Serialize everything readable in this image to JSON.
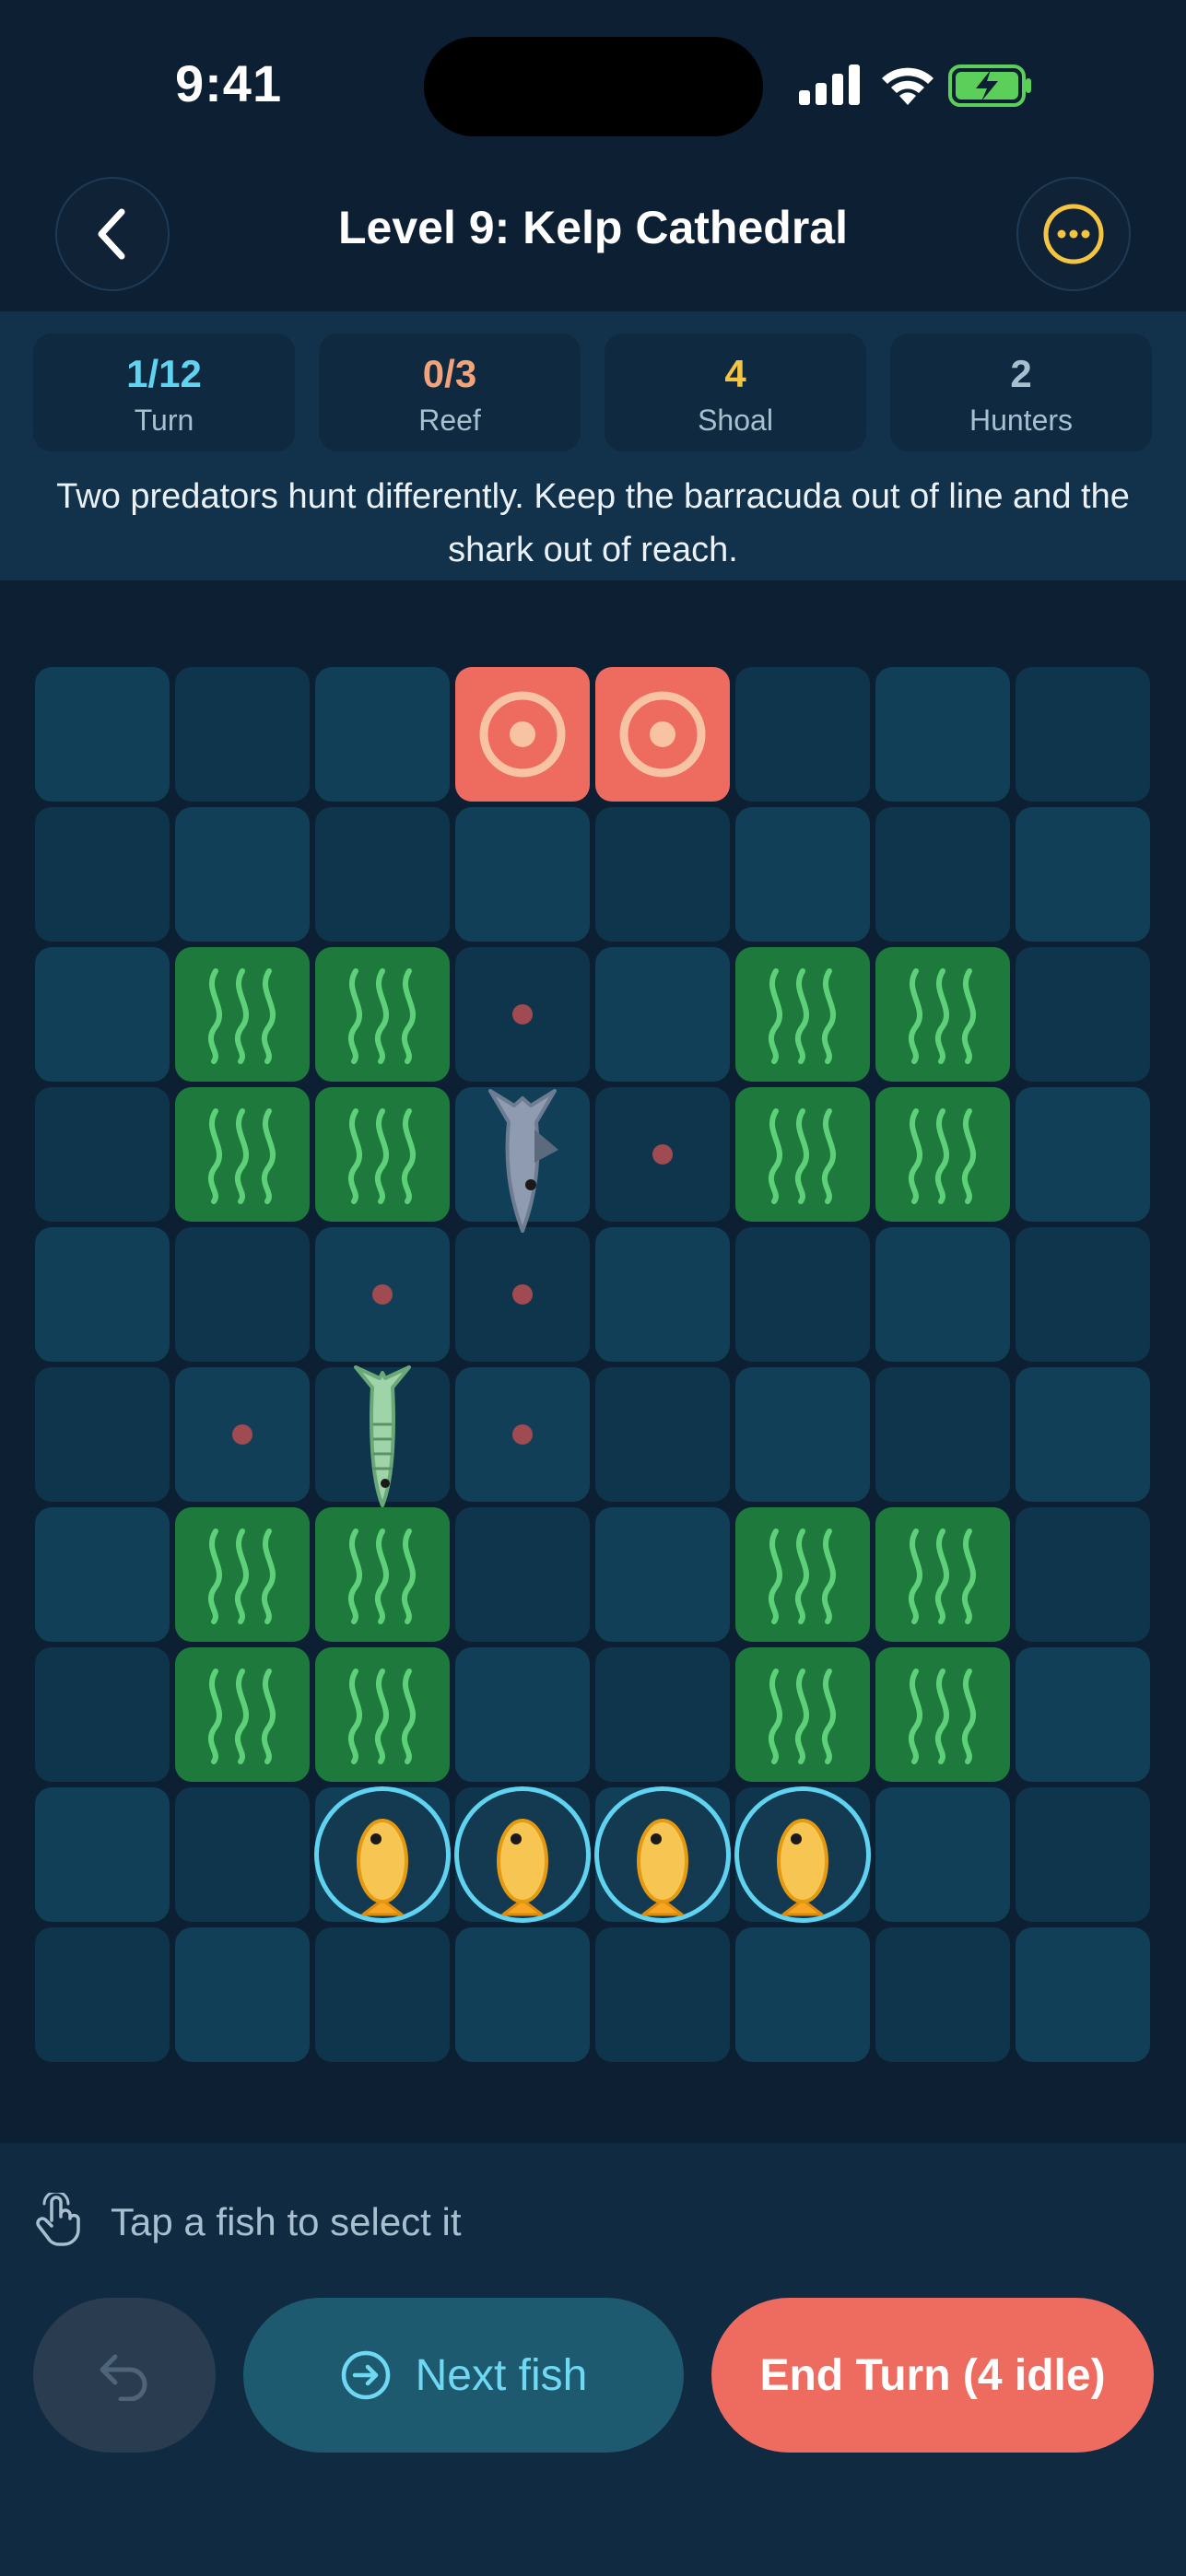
{
  "status_bar": {
    "time": "9:41"
  },
  "header": {
    "title": "Level 9: Kelp Cathedral"
  },
  "stats": [
    {
      "value": "1/12",
      "label": "Turn",
      "color": "#5fd3f0"
    },
    {
      "value": "0/3",
      "label": "Reef",
      "color": "#f2a37a"
    },
    {
      "value": "4",
      "label": "Shoal",
      "color": "#f5c542"
    },
    {
      "value": "2",
      "label": "Hunters",
      "color": "#a8bfcf"
    }
  ],
  "hint": "Two predators hunt differently. Keep the barracuda out of line and the shark out of reach.",
  "board": {
    "columns": 8,
    "rows": 10,
    "reef_cells": [
      [
        0,
        3
      ],
      [
        0,
        4
      ]
    ],
    "kelp_cells": [
      [
        2,
        1
      ],
      [
        2,
        2
      ],
      [
        2,
        5
      ],
      [
        2,
        6
      ],
      [
        3,
        1
      ],
      [
        3,
        2
      ],
      [
        3,
        5
      ],
      [
        3,
        6
      ],
      [
        6,
        1
      ],
      [
        6,
        2
      ],
      [
        6,
        5
      ],
      [
        6,
        6
      ],
      [
        7,
        1
      ],
      [
        7,
        2
      ],
      [
        7,
        5
      ],
      [
        7,
        6
      ]
    ],
    "threat_dots": [
      [
        2,
        3
      ],
      [
        3,
        4
      ],
      [
        4,
        2
      ],
      [
        4,
        3
      ],
      [
        5,
        1
      ],
      [
        5,
        3
      ]
    ],
    "shark": {
      "row": 3,
      "col": 3,
      "icon": "shark-icon"
    },
    "barracuda": {
      "row": 5,
      "col": 2,
      "icon": "barracuda-icon"
    },
    "fish": [
      {
        "row": 8,
        "col": 2,
        "selected": true
      },
      {
        "row": 8,
        "col": 3,
        "selected": true
      },
      {
        "row": 8,
        "col": 4,
        "selected": true
      },
      {
        "row": 8,
        "col": 5,
        "selected": true
      }
    ]
  },
  "footer": {
    "tap_hint": "Tap a fish to select it",
    "next_label": "Next fish",
    "end_turn_label": "End Turn (4 idle)"
  }
}
